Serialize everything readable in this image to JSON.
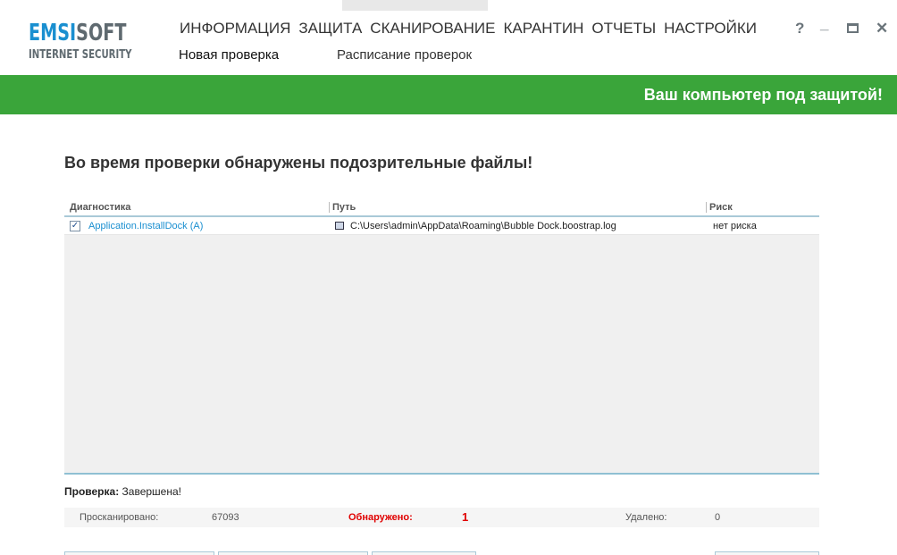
{
  "logo": {
    "part1": "EMS",
    "part2": "I",
    "part3": "SOFT",
    "subtitle": "INTERNET SECURITY"
  },
  "nav": [
    "ИНФОРМАЦИЯ",
    "ЗАЩИТА",
    "СКАНИРОВАНИЕ",
    "КАРАНТИН",
    "ОТЧЕТЫ",
    "НАСТРОЙКИ"
  ],
  "subnav": {
    "new_scan": "Новая проверка",
    "schedule": "Расписание проверок"
  },
  "window": {
    "help": "?",
    "minimize": "_",
    "maximize": "▭",
    "close": "✕"
  },
  "banner": "Ваш компьютер под защитой!",
  "heading": "Во время проверки обнаружены подозрительные файлы!",
  "table": {
    "columns": [
      "Диагностика",
      "Путь",
      "Риск"
    ],
    "rows": [
      {
        "checked": true,
        "name": "Application.InstallDock (A)",
        "path": "C:\\Users\\admin\\AppData\\Roaming\\Bubble Dock.boostrap.log",
        "risk": "нет риска"
      }
    ]
  },
  "status": {
    "label": "Проверка:",
    "value": "Завершена!"
  },
  "stats": {
    "scanned_label": "Просканировано:",
    "scanned": "67093",
    "found_label": "Обнаружено:",
    "found": "1",
    "deleted_label": "Удалено:",
    "deleted": "0"
  },
  "colors": {
    "accent": "#3aa53a",
    "link": "#1a8fd0",
    "alert": "#e00000"
  }
}
